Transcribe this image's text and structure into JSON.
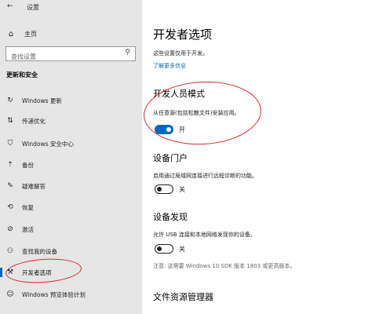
{
  "window": {
    "title": "设置"
  },
  "sidebar": {
    "home": "主页",
    "search_placeholder": "查找设置",
    "section_title": "更新和安全",
    "items": [
      {
        "label": "Windows 更新",
        "icon": "refresh-icon"
      },
      {
        "label": "传递优化",
        "icon": "delivery-icon"
      },
      {
        "label": "Windows 安全中心",
        "icon": "shield-icon"
      },
      {
        "label": "备份",
        "icon": "backup-icon"
      },
      {
        "label": "疑难解答",
        "icon": "wrench-icon"
      },
      {
        "label": "恢复",
        "icon": "recovery-icon"
      },
      {
        "label": "激活",
        "icon": "check-circle-icon"
      },
      {
        "label": "查找我的设备",
        "icon": "person-pin-icon"
      },
      {
        "label": "开发者选项",
        "icon": "developer-icon",
        "active": true
      },
      {
        "label": "Windows 预览体验计划",
        "icon": "insider-icon"
      }
    ]
  },
  "main": {
    "title": "开发者选项",
    "description": "这些设置仅用于开发。",
    "link": "了解更多信息",
    "dev_mode": {
      "heading": "开发人员模式",
      "text": "从任意源(包括松散文件)安装应用。",
      "toggle_label": "开",
      "on": true
    },
    "device_portal": {
      "heading": "设备门户",
      "text": "启用通过局域网连接进行远程诊断的功能。",
      "toggle_label": "关",
      "on": false
    },
    "device_discovery": {
      "heading": "设备发现",
      "text": "允许 USB 连接和本地网络发现你的设备。",
      "toggle_label": "关",
      "on": false,
      "note": "注意: 这需要 Windows 10 SDK 版本 1803 或更高版本。"
    },
    "file_explorer": {
      "heading": "文件资源管理器"
    }
  },
  "colors": {
    "accent": "#0067c0",
    "annotation": "#d42a2a",
    "sidebar_bg": "#e6e6e6"
  }
}
